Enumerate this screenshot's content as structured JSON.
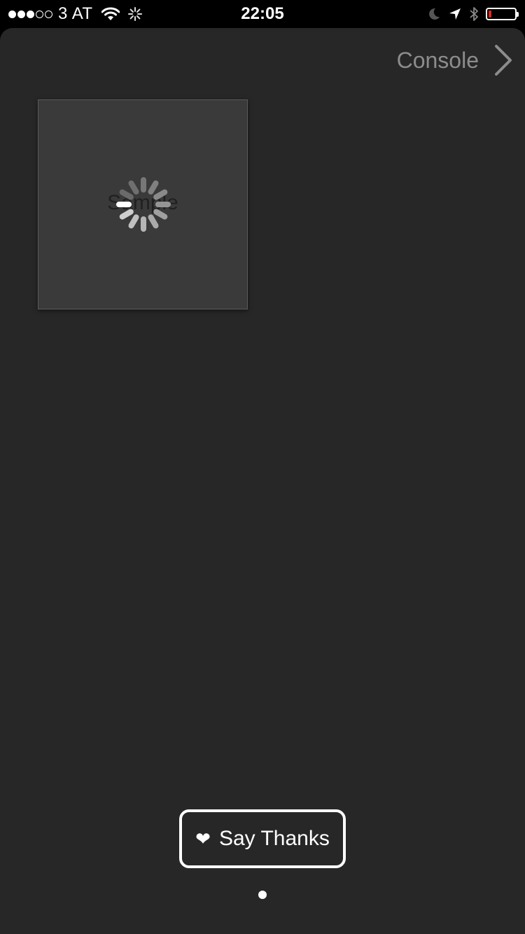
{
  "status_bar": {
    "signal_bars_filled": 3,
    "signal_bars_total": 5,
    "carrier": "3 AT",
    "time": "22:05",
    "battery_level": 0.1,
    "icons": [
      "wifi-icon",
      "activity-icon",
      "moon-icon",
      "location-icon",
      "bluetooth-icon",
      "battery-icon"
    ]
  },
  "nav": {
    "console_label": "Console"
  },
  "tile": {
    "label": "Sample"
  },
  "footer": {
    "heart": "❤",
    "thanks_label": "Say Thanks",
    "page_count": 1,
    "current_page": 1
  },
  "colors": {
    "background": "#272727",
    "tile": "#3a3a3a",
    "console_text": "#8c8c8c",
    "battery_low": "#e0281e"
  }
}
